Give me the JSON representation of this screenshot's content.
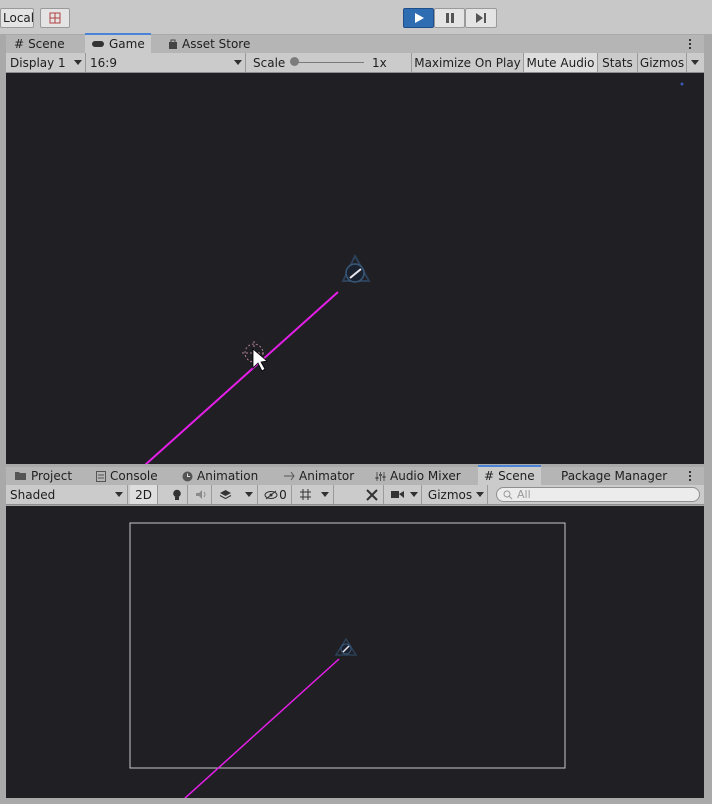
{
  "toolbar": {
    "pivot_label": "Local",
    "play_state": "playing"
  },
  "top_tabs": [
    {
      "label": "Scene",
      "icon": "hash-icon",
      "active": false
    },
    {
      "label": "Game",
      "icon": "gamepad-icon",
      "active": true
    },
    {
      "label": "Asset Store",
      "icon": "bag-icon",
      "active": false
    }
  ],
  "game_toolbar": {
    "display": "Display 1",
    "aspect": "16:9",
    "scale_label": "Scale",
    "scale_value": "1x",
    "scale_fraction": 0.0,
    "maximize": "Maximize On Play",
    "mute": "Mute Audio",
    "stats": "Stats",
    "gizmos": "Gizmos"
  },
  "bottom_tabs": [
    {
      "label": "Project",
      "icon": "folder-icon"
    },
    {
      "label": "Console",
      "icon": "console-icon"
    },
    {
      "label": "Animation",
      "icon": "clock-icon"
    },
    {
      "label": "Animator",
      "icon": "sliders-icon"
    },
    {
      "label": "Audio Mixer",
      "icon": "mixer-icon"
    },
    {
      "label": "Scene",
      "icon": "hash-icon",
      "active": true
    },
    {
      "label": "Package Manager",
      "icon": ""
    }
  ],
  "scene_toolbar": {
    "shading": "Shaded",
    "mode_2d": "2D",
    "hidden_count": "0",
    "gizmos": "Gizmos",
    "search_placeholder": "All"
  },
  "colors": {
    "viewport": "#1f1f24",
    "laser": "#e51ee8",
    "accent": "#2f6db3"
  }
}
